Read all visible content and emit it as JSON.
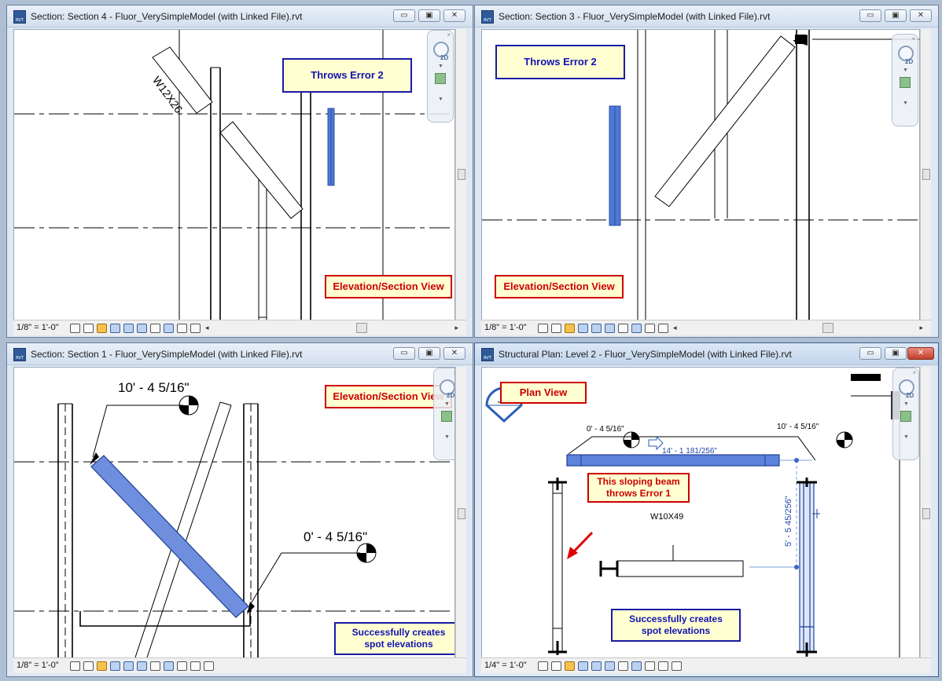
{
  "windows": {
    "w1": {
      "title": "Section: Section 4 - Fluor_VerySimpleModel (with Linked File).rvt",
      "scale": "1/8\" = 1'-0\"",
      "beam_tag": "W12X26",
      "callout_error": "Throws Error 2",
      "callout_view": "Elevation/Section View"
    },
    "w2": {
      "title": "Section: Section 3 - Fluor_VerySimpleModel (with Linked File).rvt",
      "scale": "1/8\" = 1'-0\"",
      "callout_error": "Throws Error 2",
      "callout_view": "Elevation/Section View"
    },
    "w3": {
      "title": "Section: Section 1 - Fluor_VerySimpleModel (with Linked File).rvt",
      "scale": "1/8\" = 1'-0\"",
      "elev_top": "10' - 4 5/16\"",
      "elev_bottom": "0' - 4 5/16\"",
      "callout_view": "Elevation/Section View",
      "callout_success_1": "Successfully creates",
      "callout_success_2": "spot elevations"
    },
    "w4": {
      "title": "Structural Plan: Level 2 - Fluor_VerySimpleModel (with Linked File).rvt",
      "scale": "1/4\" = 1'-0\"",
      "callout_view": "Plan View",
      "elev_left": "0' - 4 5/16\"",
      "elev_right": "10' - 4 5/16\"",
      "beam_length": "14' - 1 181/256\"",
      "vertical_dim": "5' - 5 45/256\"",
      "beam_tag": "W10X49",
      "callout_error_1": "This sloping beam",
      "callout_error_2": "throws Error 1",
      "callout_success_1": "Successfully creates",
      "callout_success_2": "spot elevations"
    }
  },
  "controls": {
    "minimize": "▭",
    "restore": "▣",
    "close": "✕",
    "nav_2d": "2D"
  },
  "colors": {
    "selected_beam": "#4f78d6",
    "callout_blue": "#1a1aa6",
    "callout_red": "#cc0000",
    "callout_fill": "#ffffd2"
  }
}
